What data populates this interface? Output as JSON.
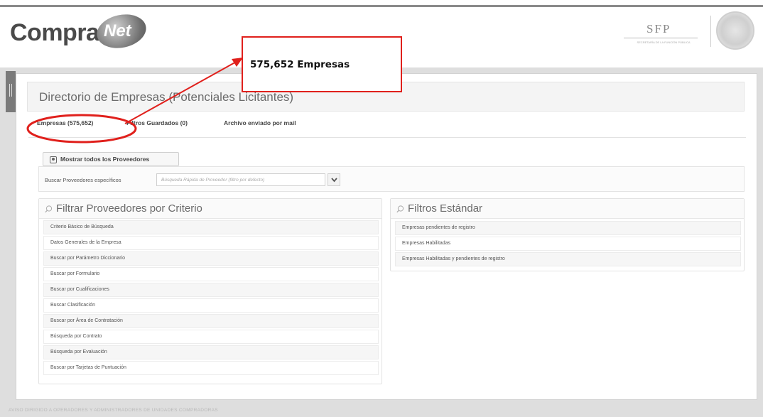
{
  "header": {
    "logo_compra": "Compra",
    "logo_net": "Net",
    "sfp_title": "SFP",
    "sfp_sub": "SECRETARÍA DE LA FUNCIÓN PÚBLICA"
  },
  "page": {
    "title": "Directorio de Empresas (Potenciales Licitantes)"
  },
  "tabs": [
    {
      "label": "Empresas (575,652)",
      "active": true
    },
    {
      "label": "Filtros Guardados (0)"
    },
    {
      "label": "Archivo enviado por mail"
    }
  ],
  "actions": {
    "show_all_label": "Mostrar todos los Proveedores"
  },
  "search": {
    "label": "Buscar Proveedores específicos",
    "placeholder": "Búsqueda Rápida de Proveedor (filtro por defecto)"
  },
  "criteria_panel": {
    "title": "Filtrar Proveedores por Criterio",
    "items": [
      "Criterio Básico de Búsqueda",
      "Datos Generales de la Empresa",
      "Buscar por Parámetro Diccionario",
      "Buscar por Formulario",
      "Buscar por Cualificaciones",
      "Buscar Clasificación",
      "Buscar por Área de Contratación",
      "Búsqueda por Contrato",
      "Búsqueda por Evaluación",
      "Buscar por Tarjetas de Puntuación"
    ]
  },
  "standard_panel": {
    "title": "Filtros Estándar",
    "items": [
      "Empresas pendientes de registro",
      "Empresas Habilitadas",
      "Empresas Habilitadas y pendientes de registro"
    ]
  },
  "footer": {
    "notice": "AVISO DIRIGIDO A OPERADORES Y ADMINISTRADORES DE UNIDADES COMPRADORAS"
  },
  "annotation": {
    "callout_text": "575,652 Empresas",
    "color": "#e0201c"
  },
  "colors": {
    "band": "#dedede",
    "panel": "#ffffff",
    "accent_red": "#e0201c"
  }
}
